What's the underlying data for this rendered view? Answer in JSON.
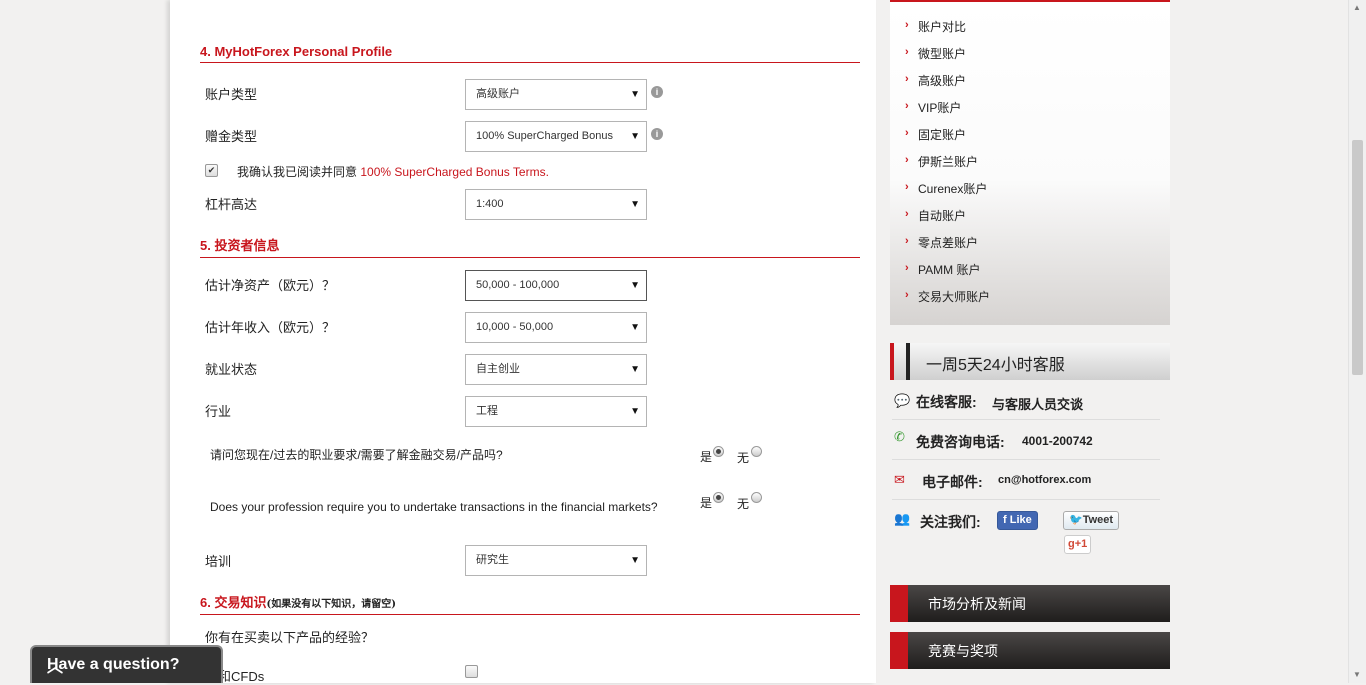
{
  "form": {
    "section4": {
      "title": "4. MyHotForex Personal Profile"
    },
    "account_type": {
      "label": "账户类型",
      "value": "高级账户"
    },
    "bonus_type": {
      "label": "赠金类型",
      "value": "100% SuperCharged Bonus"
    },
    "bonus_terms": {
      "prefix": "我确认我已阅读并同意",
      "link": "100% SuperCharged Bonus Terms."
    },
    "leverage": {
      "label": "杠杆高达",
      "value": "1:400"
    },
    "section5": {
      "title": "5. 投资者信息"
    },
    "net_worth": {
      "label": "估计净资产（欧元）？",
      "value": "50,000 - 100,000"
    },
    "annual_income": {
      "label": "估计年收入（欧元）？",
      "value": "10,000 - 50,000"
    },
    "employment": {
      "label": "就业状态",
      "value": "自主创业"
    },
    "industry": {
      "label": "行业",
      "value": "工程"
    },
    "q_cn": {
      "text": "请问您现在/过去的职业要求/需要了解金融交易/产品吗?",
      "yes": "是",
      "no": "无"
    },
    "q_en": {
      "text": "Does your profession require you to undertake transactions in the financial markets?",
      "yes": "是",
      "no": "无"
    },
    "education": {
      "label": "培训",
      "value": "研究生"
    },
    "section6": {
      "title": "6. 交易知识",
      "subtitle": "(如果没有以下知识，请留空)"
    },
    "experience_q": "你有在买卖以下产品的经验？",
    "cfd_label": "汇和CFDs"
  },
  "sidebar": {
    "menu": [
      "账户对比",
      "微型账户",
      "高级账户",
      "VIP账户",
      "固定账户",
      "伊斯兰账户",
      "Curenex账户",
      "自动账户",
      "零点差账户",
      "PAMM 账户",
      "交易大师账户"
    ],
    "support_title": "一周5天24小时客服",
    "live_chat": {
      "label": "在线客服:",
      "value": "与客服人员交谈"
    },
    "phone": {
      "label": "免费咨询电话:",
      "value": "4001-200742"
    },
    "email": {
      "label": "电子邮件:",
      "value": "cn@hotforex.com"
    },
    "follow": {
      "label": "关注我们:",
      "like": "Like",
      "tweet": "Tweet",
      "gplus": "+1"
    },
    "market_news": "市场分析及新闻",
    "contests": "竞赛与奖项"
  },
  "widget": {
    "question": "Have a question?"
  },
  "colors": {
    "accent": "#c8161d"
  }
}
